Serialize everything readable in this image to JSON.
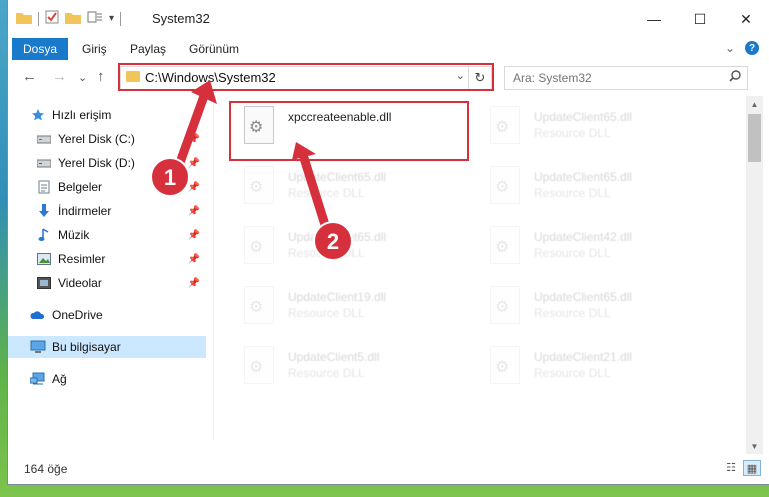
{
  "window": {
    "title": "System32",
    "controls": {
      "minimize": "—",
      "maximize": "☐",
      "close": "✕"
    }
  },
  "ribbon": {
    "file_tab": "Dosya",
    "tabs": [
      "Giriş",
      "Paylaş",
      "Görünüm"
    ],
    "collapse": "⌄",
    "help": "?"
  },
  "address": {
    "path": "C:\\Windows\\System32",
    "dropdown": "⌄",
    "refresh": "↻"
  },
  "search": {
    "placeholder": "Ara: System32",
    "icon": "search-icon"
  },
  "navigation": {
    "back": "←",
    "forward": "→",
    "recent": "⌄",
    "up": "↑"
  },
  "sidebar": {
    "items": [
      {
        "label": "Hızlı erişim",
        "icon": "star-icon",
        "color": "#3a8fd8"
      },
      {
        "label": "Yerel Disk (C:)",
        "icon": "drive-icon",
        "pinned": true
      },
      {
        "label": "Yerel Disk (D:)",
        "icon": "drive-icon",
        "pinned": true
      },
      {
        "label": "Belgeler",
        "icon": "documents-icon",
        "pinned": true
      },
      {
        "label": "İndirmeler",
        "icon": "download-icon",
        "pinned": true,
        "color": "#2b79d6"
      },
      {
        "label": "Müzik",
        "icon": "music-icon",
        "pinned": true,
        "color": "#2b79d6"
      },
      {
        "label": "Resimler",
        "icon": "pictures-icon",
        "pinned": true
      },
      {
        "label": "Videolar",
        "icon": "videos-icon",
        "pinned": true
      },
      {
        "label": "OneDrive",
        "icon": "cloud-icon",
        "color": "#1f6fce"
      },
      {
        "label": "Bu bilgisayar",
        "icon": "computer-icon",
        "selected": true
      },
      {
        "label": "Ağ",
        "icon": "network-icon"
      }
    ]
  },
  "files": [
    {
      "name": "xpccreateenable.dll",
      "type": "",
      "highlighted": true
    },
    {
      "name": "UpdateClient65.dll",
      "type": "Resource DLL"
    },
    {
      "name": "UpdateClient65.dll",
      "type": "Resource DLL"
    },
    {
      "name": "UpdateClient65.dll",
      "type": "Resource DLL"
    },
    {
      "name": "UpdateClient65.dll",
      "type": "Resource DLL"
    },
    {
      "name": "UpdateClient42.dll",
      "type": "Resource DLL"
    },
    {
      "name": "UpdateClient19.dll",
      "type": "Resource DLL"
    },
    {
      "name": "UpdateClient65.dll",
      "type": "Resource DLL"
    },
    {
      "name": "UpdateClient5.dll",
      "type": "Resource DLL"
    },
    {
      "name": "UpdateClient21.dll",
      "type": "Resource DLL"
    }
  ],
  "status": {
    "item_count": "164 öğe"
  },
  "annotations": {
    "step1": "1",
    "step2": "2",
    "color": "#d6303d"
  }
}
